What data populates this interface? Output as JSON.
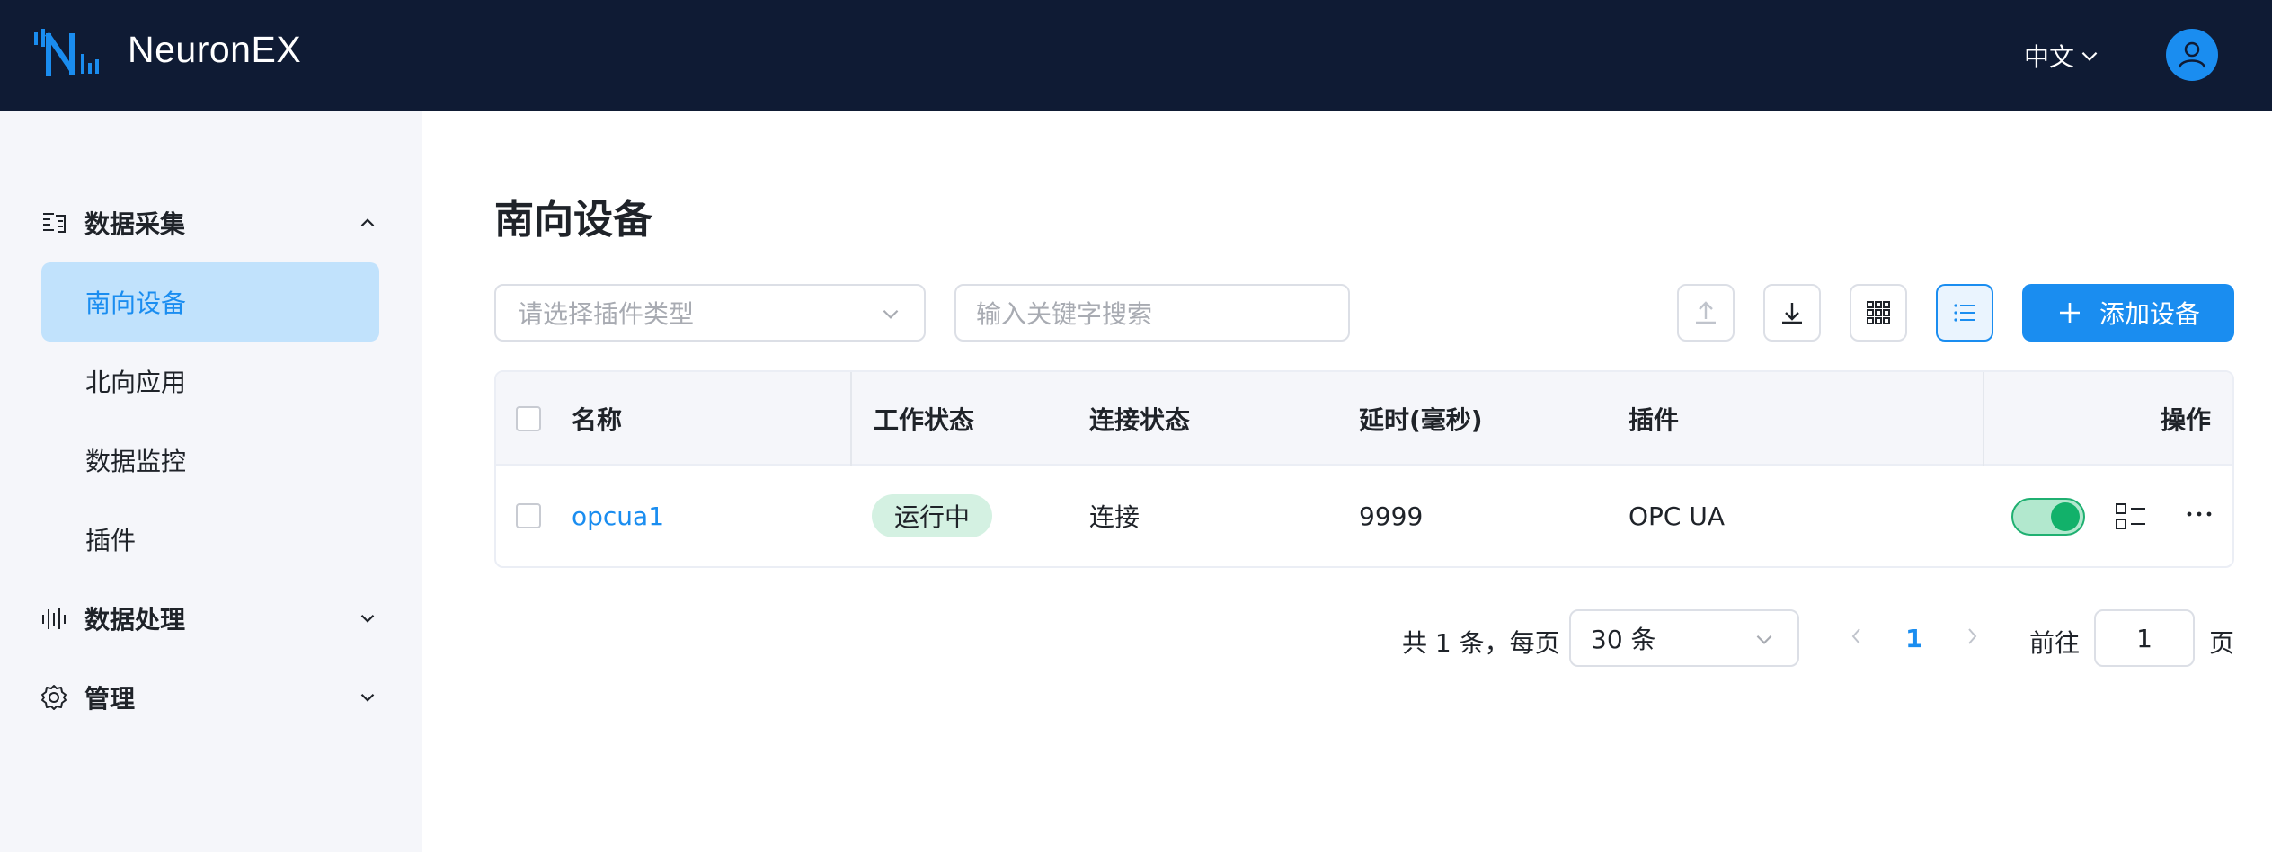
{
  "header": {
    "brand": "NeuronEX",
    "language": "中文"
  },
  "sidebar": {
    "groups": [
      {
        "label": "数据采集",
        "icon": "data-collection-icon",
        "expanded": true
      },
      {
        "label": "数据处理",
        "icon": "data-processing-icon",
        "expanded": false
      },
      {
        "label": "管理",
        "icon": "gear-icon",
        "expanded": false
      }
    ],
    "items": [
      {
        "label": "南向设备",
        "active": true
      },
      {
        "label": "北向应用",
        "active": false
      },
      {
        "label": "数据监控",
        "active": false
      },
      {
        "label": "插件",
        "active": false
      }
    ]
  },
  "main": {
    "title": "南向设备",
    "plugin_select_placeholder": "请选择插件类型",
    "search_placeholder": "输入关键字搜索",
    "add_button": "添加设备",
    "view_mode": "list"
  },
  "table": {
    "columns": [
      "名称",
      "工作状态",
      "连接状态",
      "延时(毫秒)",
      "插件",
      "操作"
    ],
    "rows": [
      {
        "name": "opcua1",
        "work_status": "运行中",
        "connection": "连接",
        "delay": "9999",
        "plugin": "OPC UA",
        "enabled": true
      }
    ]
  },
  "pagination": {
    "total_text": "共 1 条，每页",
    "page_size": "30 条",
    "current_page": "1",
    "goto_label": "前往",
    "goto_value": "1",
    "page_unit": "页"
  },
  "colors": {
    "header_bg": "#0f1b34",
    "accent": "#1a8df0",
    "sidebar_bg": "#f5f6fa",
    "active_item_bg": "#c1e2fc",
    "running_tag_bg": "#d4f1e2",
    "toggle_on": "#12b16a"
  }
}
